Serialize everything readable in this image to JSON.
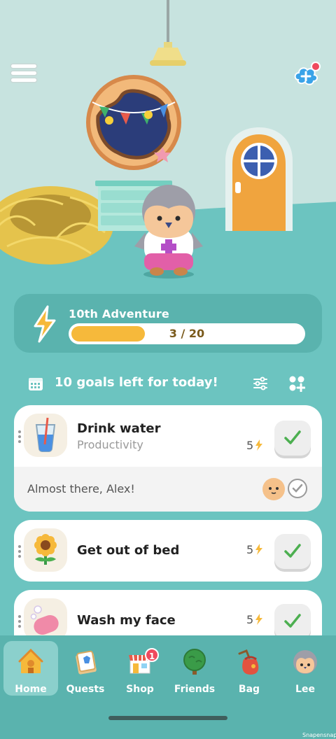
{
  "room": {
    "menu_icon": "hamburger-menu-icon",
    "add_friend_icon": "add-friend-icon"
  },
  "adventure": {
    "title": "10th Adventure",
    "progress_text": "3 / 20",
    "progress_value": 3,
    "progress_max": 20,
    "accent": "#f6b93b"
  },
  "goals": {
    "header": "10 goals left for today!",
    "items": [
      {
        "title": "Drink water",
        "category": "Productivity",
        "points": "5",
        "icon": "water-glass-icon"
      },
      {
        "title": "Get out of bed",
        "category": "",
        "points": "5",
        "icon": "sunflower-icon"
      },
      {
        "title": "Wash my face",
        "category": "",
        "points": "5",
        "icon": "soap-icon"
      }
    ],
    "encouragement": "Almost there, Alex!"
  },
  "nav": {
    "items": [
      {
        "label": "Home",
        "icon": "house-icon",
        "active": true
      },
      {
        "label": "Quests",
        "icon": "quest-icon"
      },
      {
        "label": "Shop",
        "icon": "shop-icon",
        "badge": "1"
      },
      {
        "label": "Friends",
        "icon": "tree-icon"
      },
      {
        "label": "Bag",
        "icon": "bag-icon"
      },
      {
        "label": "Lee",
        "icon": "profile-avatar-icon"
      }
    ]
  },
  "watermark": "Snapensnap"
}
